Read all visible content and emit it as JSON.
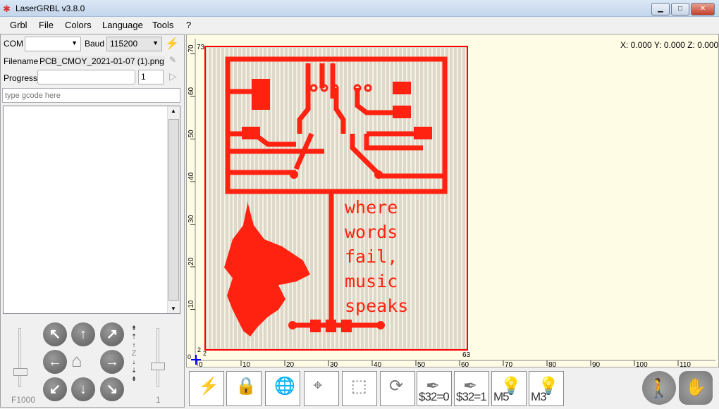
{
  "window": {
    "title": "LaserGRBL v3.8.0",
    "minimize": "▁",
    "maximize": "□",
    "close": "✕"
  },
  "menu": [
    "Grbl",
    "File",
    "Colors",
    "Language",
    "Tools",
    "?"
  ],
  "connection": {
    "com_label": "COM",
    "com_value": "",
    "baud_label": "Baud",
    "baud_value": "115200"
  },
  "file": {
    "filename_label": "Filename",
    "filename_value": "PCB_CMOY_2021-01-07 (1).png",
    "progress_label": "Progress",
    "copies": "1"
  },
  "gcode": {
    "placeholder": "type gcode here"
  },
  "jog": {
    "feed_label": "F1000",
    "step_label": "1",
    "z_label": "Z",
    "feed_level": 0.15,
    "step_level": 0.25
  },
  "canvas": {
    "coords": "X: 0.000 Y: 0.000 Z: 0.000",
    "x_ticks": [
      "0",
      "10",
      "20",
      "30",
      "40",
      "50",
      "60",
      "70",
      "80",
      "90",
      "100",
      "110"
    ],
    "y_ticks": [
      "10",
      "20",
      "30",
      "40",
      "50",
      "60",
      "70"
    ],
    "origin": "0",
    "img_height": "73",
    "img_width": "63",
    "img_x": "2",
    "img_y": "2",
    "artwork_text": [
      "where",
      "words",
      "fail,",
      "music",
      "speaks"
    ],
    "accent": "#ff1a1a"
  },
  "toolbar": {
    "buttons": [
      {
        "name": "connect",
        "label": ""
      },
      {
        "name": "unlock",
        "label": ""
      },
      {
        "name": "global-home",
        "label": ""
      },
      {
        "name": "center",
        "label": ""
      },
      {
        "name": "frame",
        "label": ""
      },
      {
        "name": "reset",
        "label": ""
      },
      {
        "name": "pen-up",
        "label": "$32=0"
      },
      {
        "name": "pen-down",
        "label": "$32=1"
      },
      {
        "name": "laser-off",
        "label": "M5"
      },
      {
        "name": "laser-on",
        "label": "M3"
      }
    ],
    "right": [
      {
        "name": "resume"
      },
      {
        "name": "stop"
      }
    ]
  }
}
